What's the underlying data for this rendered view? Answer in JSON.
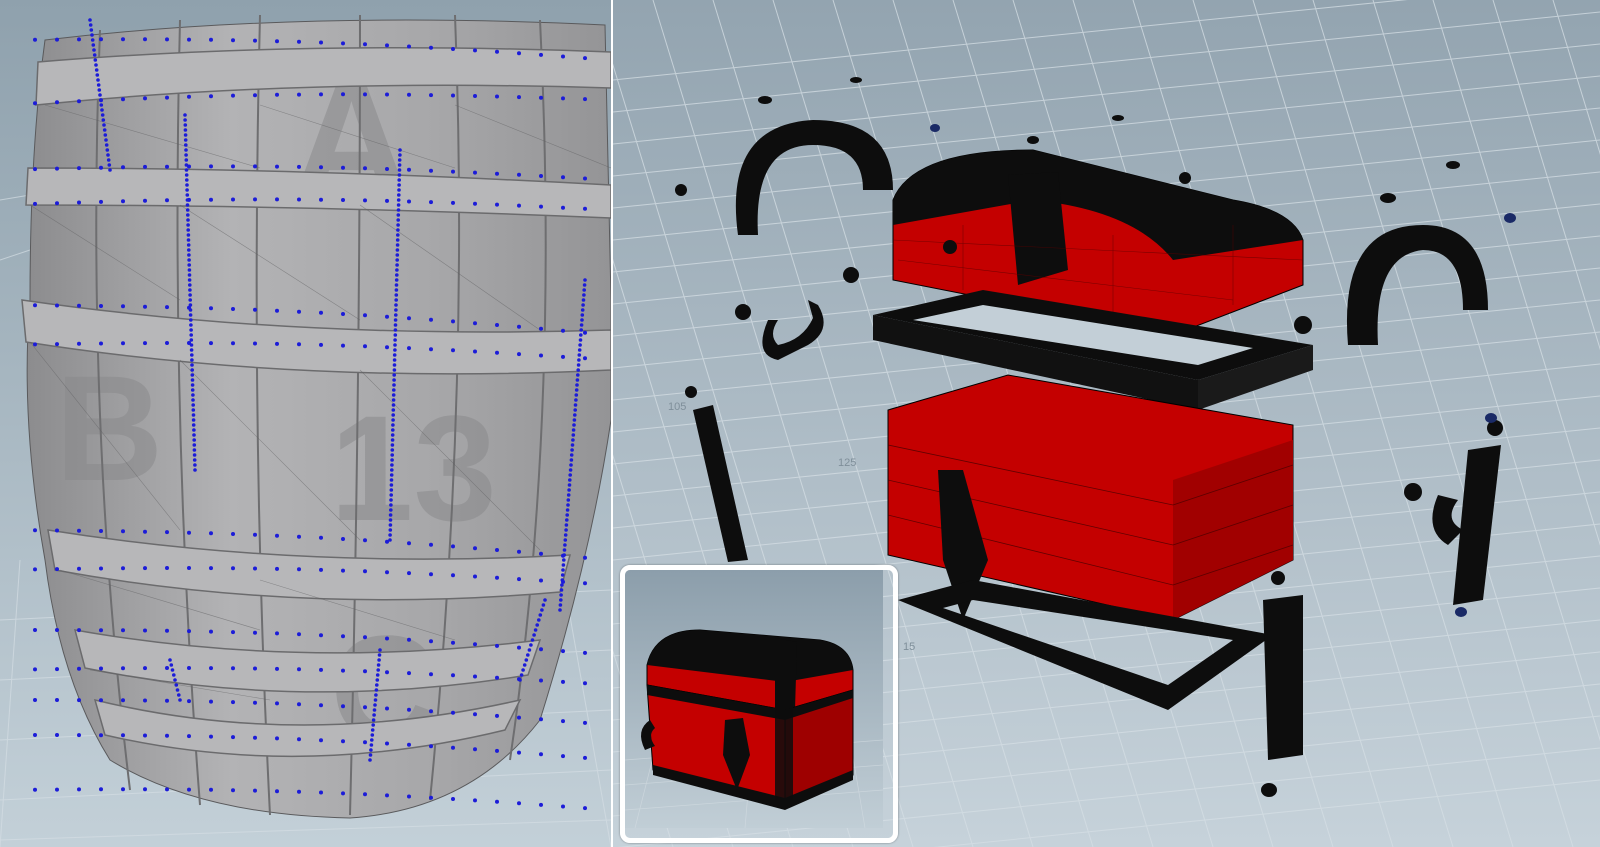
{
  "colors": {
    "viewport_bg_light": "#b9c7d0",
    "viewport_bg_dark": "#8d9eaa",
    "grid_line": "#d4dde3",
    "barrel_gray": "#a9a9ab",
    "vertex_blue": "#1c1cd8",
    "chest_red": "#c40000",
    "chest_black": "#0d0d0d",
    "inset_border": "#ffffff"
  },
  "viewports": {
    "left": {
      "subject": "barrel wireframe with selected vertices"
    },
    "right": {
      "subject": "exploded treasure chest parts"
    },
    "inset": {
      "subject": "assembled treasure chest preview"
    }
  },
  "barrel_decals": [
    "A",
    "B",
    "13",
    "C"
  ],
  "grid_labels": [
    "105",
    "125",
    "15"
  ]
}
